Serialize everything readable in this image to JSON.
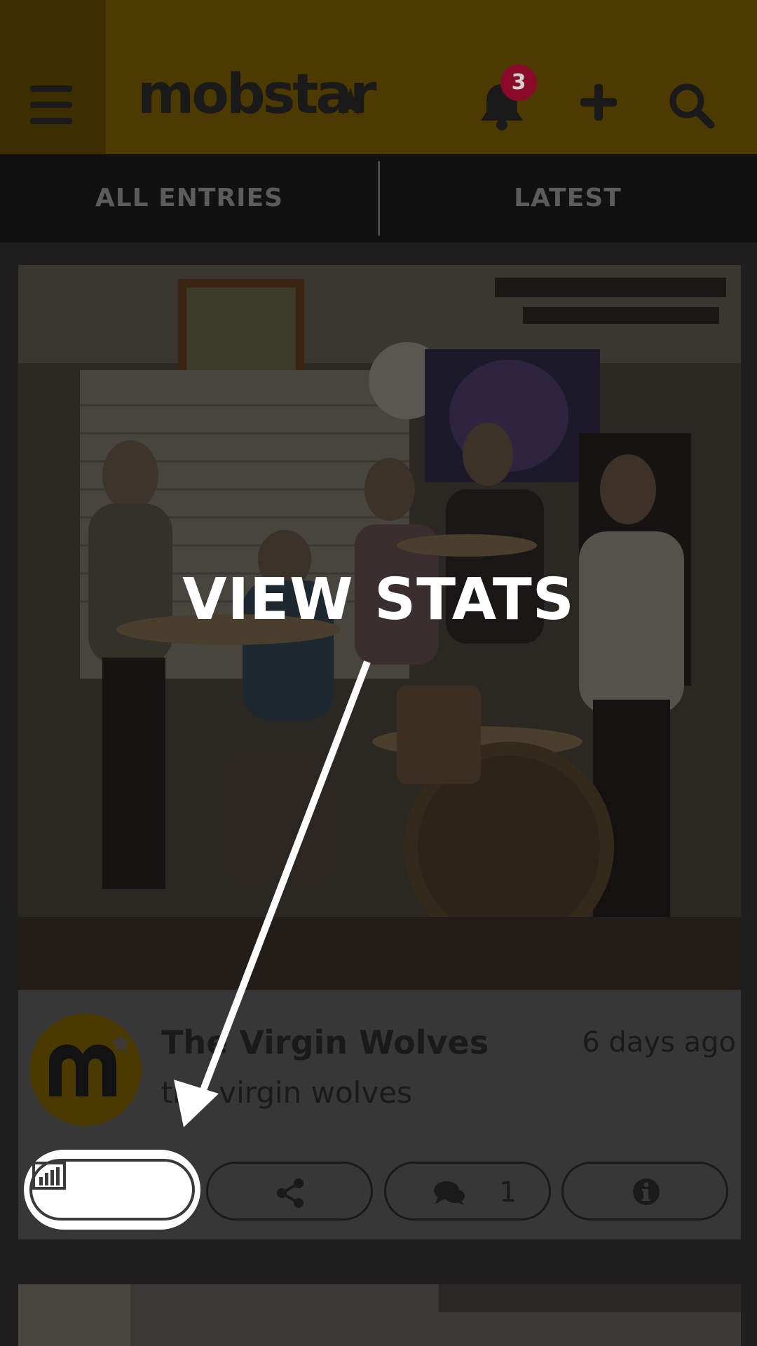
{
  "header": {
    "logo_text": "mobstar",
    "notification_count": "3",
    "icons": [
      "menu-icon",
      "bell-icon",
      "plus-icon",
      "search-icon"
    ]
  },
  "tabs": [
    {
      "label": "ALL ENTRIES"
    },
    {
      "label": "LATEST"
    }
  ],
  "entry": {
    "overlay_label": "VIEW STATS",
    "title": "The Virgin Wolves",
    "time": "6 days ago",
    "username": "the virgin wolves",
    "actions": {
      "stats_icon": "bar-chart-icon",
      "share_icon": "share-icon",
      "comment_icon": "comments-icon",
      "comment_count": "1",
      "info_icon": "info-icon"
    }
  },
  "colors": {
    "brand_yellow": "#4d3a00",
    "tab_bar": "#111111",
    "background": "#1f1f1f",
    "highlight": "#ffffff",
    "notification_badge": "#8a0a2a"
  }
}
